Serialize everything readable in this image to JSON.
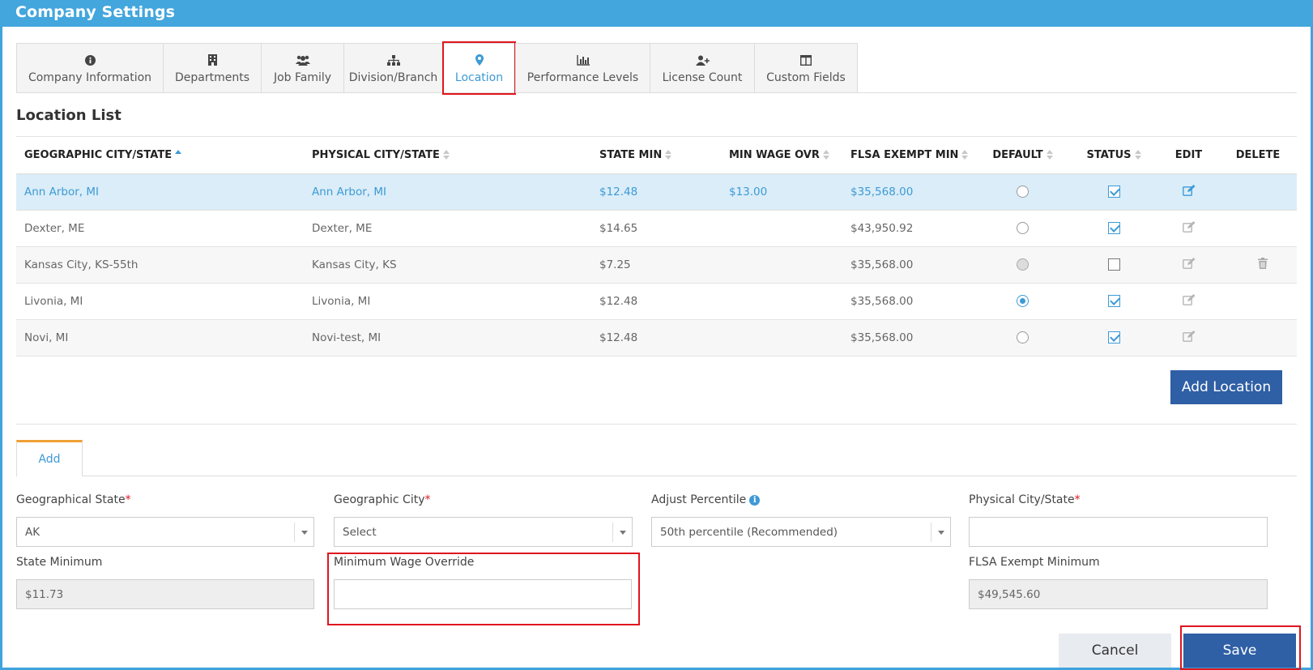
{
  "window": {
    "title": "Company Settings"
  },
  "tabs": [
    {
      "label": "Company Information",
      "icon": "info-circle-icon"
    },
    {
      "label": "Departments",
      "icon": "building-icon"
    },
    {
      "label": "Job Family",
      "icon": "users-icon"
    },
    {
      "label": "Division/Branch",
      "icon": "sitemap-icon"
    },
    {
      "label": "Location",
      "icon": "map-marker-icon",
      "active": true
    },
    {
      "label": "Performance Levels",
      "icon": "bar-chart-icon"
    },
    {
      "label": "License Count",
      "icon": "user-plus-icon"
    },
    {
      "label": "Custom Fields",
      "icon": "columns-icon"
    }
  ],
  "location_list": {
    "title": "Location List",
    "columns": {
      "geographic": "GEOGRAPHIC CITY/STATE",
      "physical": "PHYSICAL CITY/STATE",
      "state_min": "STATE MIN",
      "min_wage_ovr": "MIN WAGE OVR",
      "flsa": "FLSA EXEMPT MIN",
      "default": "DEFAULT",
      "status": "STATUS",
      "edit": "EDIT",
      "delete": "DELETE"
    },
    "rows": [
      {
        "geographic": "Ann Arbor, MI",
        "physical": "Ann Arbor, MI",
        "state_min": "$12.48",
        "min_wage_ovr": "$13.00",
        "flsa": "$35,568.00",
        "default": "off",
        "status": true,
        "deletable": false
      },
      {
        "geographic": "Dexter, ME",
        "physical": "Dexter, ME",
        "state_min": "$14.65",
        "min_wage_ovr": "",
        "flsa": "$43,950.92",
        "default": "off",
        "status": true,
        "deletable": false
      },
      {
        "geographic": "Kansas City, KS-55th",
        "physical": "Kansas City, KS",
        "state_min": "$7.25",
        "min_wage_ovr": "",
        "flsa": "$35,568.00",
        "default": "disabled",
        "status": false,
        "deletable": true
      },
      {
        "geographic": "Livonia, MI",
        "physical": "Livonia, MI",
        "state_min": "$12.48",
        "min_wage_ovr": "",
        "flsa": "$35,568.00",
        "default": "on",
        "status": true,
        "deletable": false
      },
      {
        "geographic": "Novi, MI",
        "physical": "Novi-test, MI",
        "state_min": "$12.48",
        "min_wage_ovr": "",
        "flsa": "$35,568.00",
        "default": "off",
        "status": true,
        "deletable": false
      }
    ],
    "add_button": "Add Location"
  },
  "form": {
    "tab_label": "Add",
    "geo_state": {
      "label": "Geographical State",
      "value": "AK"
    },
    "geo_city": {
      "label": "Geographic City",
      "value": "Select"
    },
    "percentile": {
      "label": "Adjust Percentile",
      "value": "50th percentile (Recommended)"
    },
    "physical": {
      "label": "Physical City/State",
      "value": ""
    },
    "state_min": {
      "label": "State Minimum",
      "value": "$11.73"
    },
    "min_wage_override": {
      "label": "Minimum Wage Override",
      "value": ""
    },
    "flsa_min": {
      "label": "FLSA Exempt Minimum",
      "value": "$49,545.60"
    },
    "required_mark": "*",
    "cancel": "Cancel",
    "save": "Save"
  },
  "colors": {
    "accent": "#3d9ad6",
    "titlebar": "#43a6dd",
    "primary_button": "#2f5fa5",
    "highlight": "#e0151e"
  }
}
